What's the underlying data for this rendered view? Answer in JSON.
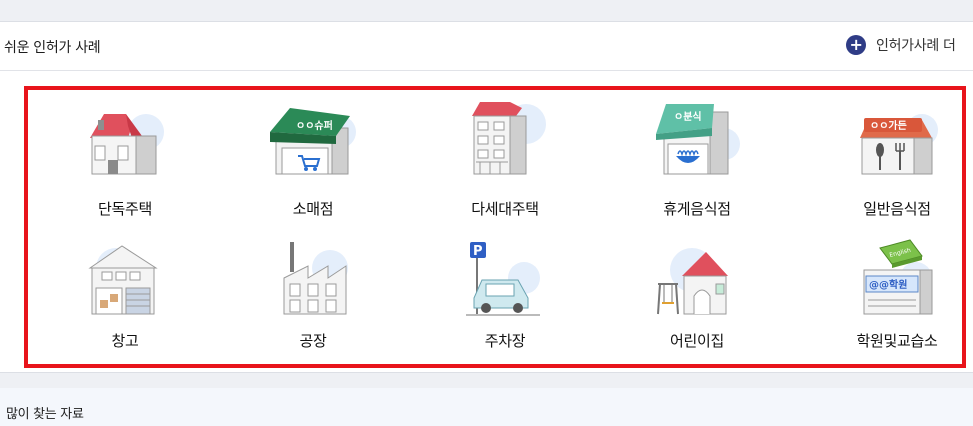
{
  "header": {
    "title": "쉬운 인허가 사례",
    "more_label": "인허가사례 더",
    "more_icon": "plus-circle-icon"
  },
  "cases": [
    {
      "label": "단독주택",
      "icon": "detached-house-icon"
    },
    {
      "label": "소매점",
      "icon": "retail-store-icon",
      "sign": "ㅇㅇ슈퍼"
    },
    {
      "label": "다세대주택",
      "icon": "multi-family-house-icon"
    },
    {
      "label": "휴게음식점",
      "icon": "snack-restaurant-icon",
      "sign": "ㅇ분식"
    },
    {
      "label": "일반음식점",
      "icon": "general-restaurant-icon",
      "sign": "ㅇㅇ가든"
    },
    {
      "label": "창고",
      "icon": "warehouse-icon"
    },
    {
      "label": "공장",
      "icon": "factory-icon"
    },
    {
      "label": "주차장",
      "icon": "parking-lot-icon",
      "sign": "P"
    },
    {
      "label": "어린이집",
      "icon": "daycare-icon"
    },
    {
      "label": "학원및교습소",
      "icon": "academy-icon",
      "sign": "@@학원",
      "book": "English"
    }
  ],
  "footer_section": {
    "title": "많이 찾는 자료"
  },
  "colors": {
    "highlight_border": "#e8141b",
    "plus_icon": "#2f3c86",
    "circle_bg": "#e4eefb"
  }
}
